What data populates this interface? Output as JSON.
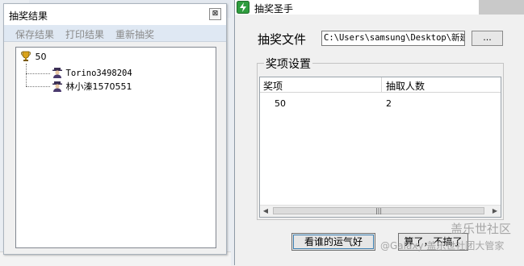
{
  "left_window": {
    "title": "抽奖结果",
    "close_glyph": "⊠",
    "menu": [
      "保存结果",
      "打印结果",
      "重新抽奖"
    ],
    "tree": {
      "root_label": "50",
      "root_icon": "trophy-icon",
      "children": [
        {
          "label": "Torino3498204",
          "icon": "user-icon"
        },
        {
          "label": "林小溱1570551",
          "icon": "user-icon"
        }
      ]
    }
  },
  "right_window": {
    "title": "抽奖圣手",
    "file_label": "抽奖文件",
    "file_value": "C:\\Users\\samsung\\Desktop\\新建",
    "browse_label": "...",
    "group_title": "奖项设置",
    "table": {
      "columns": [
        "奖项",
        "抽取人数"
      ],
      "rows": [
        [
          "50",
          "2"
        ]
      ]
    },
    "scroll_thumb_glyph": "|||",
    "buttons": {
      "luck": "看谁的运气好",
      "other": "算了，不搞了"
    }
  },
  "watermark": {
    "line1": "盖乐世社区",
    "line2": "@Galaxy 盖乐世社团大管家"
  },
  "colors": {
    "menubar": "#dfe8f3",
    "menu_text_disabled": "#8a8a8a",
    "icon_green": "#2e9c3e"
  }
}
